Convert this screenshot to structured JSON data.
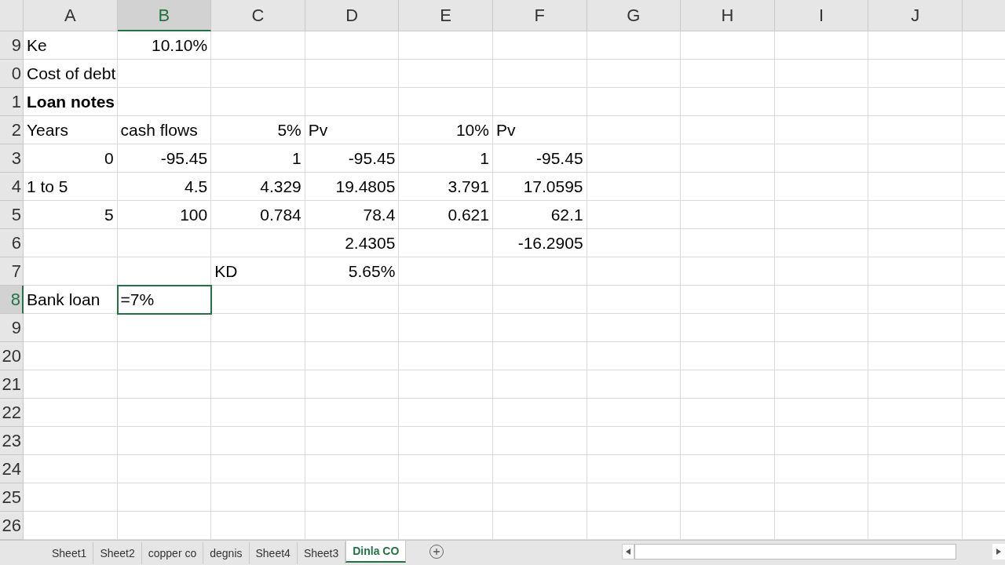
{
  "columns": [
    {
      "label": "A",
      "selected": false
    },
    {
      "label": "B",
      "selected": true
    },
    {
      "label": "C",
      "selected": false
    },
    {
      "label": "D",
      "selected": false
    },
    {
      "label": "E",
      "selected": false
    },
    {
      "label": "F",
      "selected": false
    },
    {
      "label": "G",
      "selected": false
    },
    {
      "label": "H",
      "selected": false
    },
    {
      "label": "I",
      "selected": false
    },
    {
      "label": "J",
      "selected": false
    }
  ],
  "rows": [
    {
      "header": "9",
      "selected": false,
      "cells": [
        {
          "text": "Ke",
          "kind": "text"
        },
        {
          "text": "10.10%",
          "kind": "number"
        },
        null,
        null,
        null,
        null,
        null,
        null,
        null,
        null
      ]
    },
    {
      "header": "0",
      "selected": false,
      "cells": [
        {
          "text": "Cost of debt",
          "kind": "text"
        },
        null,
        null,
        null,
        null,
        null,
        null,
        null,
        null,
        null
      ]
    },
    {
      "header": "1",
      "selected": false,
      "cells": [
        {
          "text": "Loan notes",
          "kind": "text",
          "bold": true
        },
        null,
        null,
        null,
        null,
        null,
        null,
        null,
        null,
        null
      ]
    },
    {
      "header": "2",
      "selected": false,
      "cells": [
        {
          "text": "Years",
          "kind": "text"
        },
        {
          "text": "cash flows",
          "kind": "text"
        },
        {
          "text": "5%",
          "kind": "number"
        },
        {
          "text": "Pv",
          "kind": "text"
        },
        {
          "text": "10%",
          "kind": "number"
        },
        {
          "text": "Pv",
          "kind": "text"
        },
        null,
        null,
        null,
        null
      ]
    },
    {
      "header": "3",
      "selected": false,
      "cells": [
        {
          "text": "0",
          "kind": "number"
        },
        {
          "text": "-95.45",
          "kind": "number"
        },
        {
          "text": "1",
          "kind": "number"
        },
        {
          "text": "-95.45",
          "kind": "number"
        },
        {
          "text": "1",
          "kind": "number"
        },
        {
          "text": "-95.45",
          "kind": "number"
        },
        null,
        null,
        null,
        null
      ]
    },
    {
      "header": "4",
      "selected": false,
      "cells": [
        {
          "text": "1 to 5",
          "kind": "text"
        },
        {
          "text": "4.5",
          "kind": "number"
        },
        {
          "text": "4.329",
          "kind": "number"
        },
        {
          "text": "19.4805",
          "kind": "number"
        },
        {
          "text": "3.791",
          "kind": "number"
        },
        {
          "text": "17.0595",
          "kind": "number"
        },
        null,
        null,
        null,
        null
      ]
    },
    {
      "header": "5",
      "selected": false,
      "cells": [
        {
          "text": "5",
          "kind": "number"
        },
        {
          "text": "100",
          "kind": "number"
        },
        {
          "text": "0.784",
          "kind": "number"
        },
        {
          "text": "78.4",
          "kind": "number"
        },
        {
          "text": "0.621",
          "kind": "number"
        },
        {
          "text": "62.1",
          "kind": "number"
        },
        null,
        null,
        null,
        null
      ]
    },
    {
      "header": "6",
      "selected": false,
      "cells": [
        null,
        null,
        null,
        {
          "text": "2.4305",
          "kind": "number"
        },
        null,
        {
          "text": "-16.2905",
          "kind": "number"
        },
        null,
        null,
        null,
        null
      ]
    },
    {
      "header": "7",
      "selected": false,
      "cells": [
        null,
        null,
        {
          "text": "KD",
          "kind": "text"
        },
        {
          "text": "5.65%",
          "kind": "number"
        },
        null,
        null,
        null,
        null,
        null,
        null
      ]
    },
    {
      "header": "8",
      "selected": true,
      "cells": [
        {
          "text": "Bank loan",
          "kind": "text"
        },
        {
          "text": "=7%",
          "kind": "text",
          "selected": true
        },
        null,
        null,
        null,
        null,
        null,
        null,
        null,
        null
      ]
    },
    {
      "header": "9",
      "selected": false,
      "cells": [
        null,
        null,
        null,
        null,
        null,
        null,
        null,
        null,
        null,
        null
      ]
    },
    {
      "header": "20",
      "selected": false,
      "cells": [
        null,
        null,
        null,
        null,
        null,
        null,
        null,
        null,
        null,
        null
      ]
    },
    {
      "header": "21",
      "selected": false,
      "cells": [
        null,
        null,
        null,
        null,
        null,
        null,
        null,
        null,
        null,
        null
      ]
    },
    {
      "header": "22",
      "selected": false,
      "cells": [
        null,
        null,
        null,
        null,
        null,
        null,
        null,
        null,
        null,
        null
      ]
    },
    {
      "header": "23",
      "selected": false,
      "cells": [
        null,
        null,
        null,
        null,
        null,
        null,
        null,
        null,
        null,
        null
      ]
    },
    {
      "header": "24",
      "selected": false,
      "cells": [
        null,
        null,
        null,
        null,
        null,
        null,
        null,
        null,
        null,
        null
      ]
    },
    {
      "header": "25",
      "selected": false,
      "cells": [
        null,
        null,
        null,
        null,
        null,
        null,
        null,
        null,
        null,
        null
      ]
    },
    {
      "header": "26",
      "selected": false,
      "cells": [
        null,
        null,
        null,
        null,
        null,
        null,
        null,
        null,
        null,
        null
      ]
    }
  ],
  "sheet_tabs": [
    {
      "label": "Sheet1",
      "selected": false
    },
    {
      "label": "Sheet2",
      "selected": false
    },
    {
      "label": "copper co",
      "selected": false
    },
    {
      "label": "degnis",
      "selected": false
    },
    {
      "label": "Sheet4",
      "selected": false
    },
    {
      "label": "Sheet3",
      "selected": false
    },
    {
      "label": "Dinla CO",
      "selected": true
    }
  ]
}
